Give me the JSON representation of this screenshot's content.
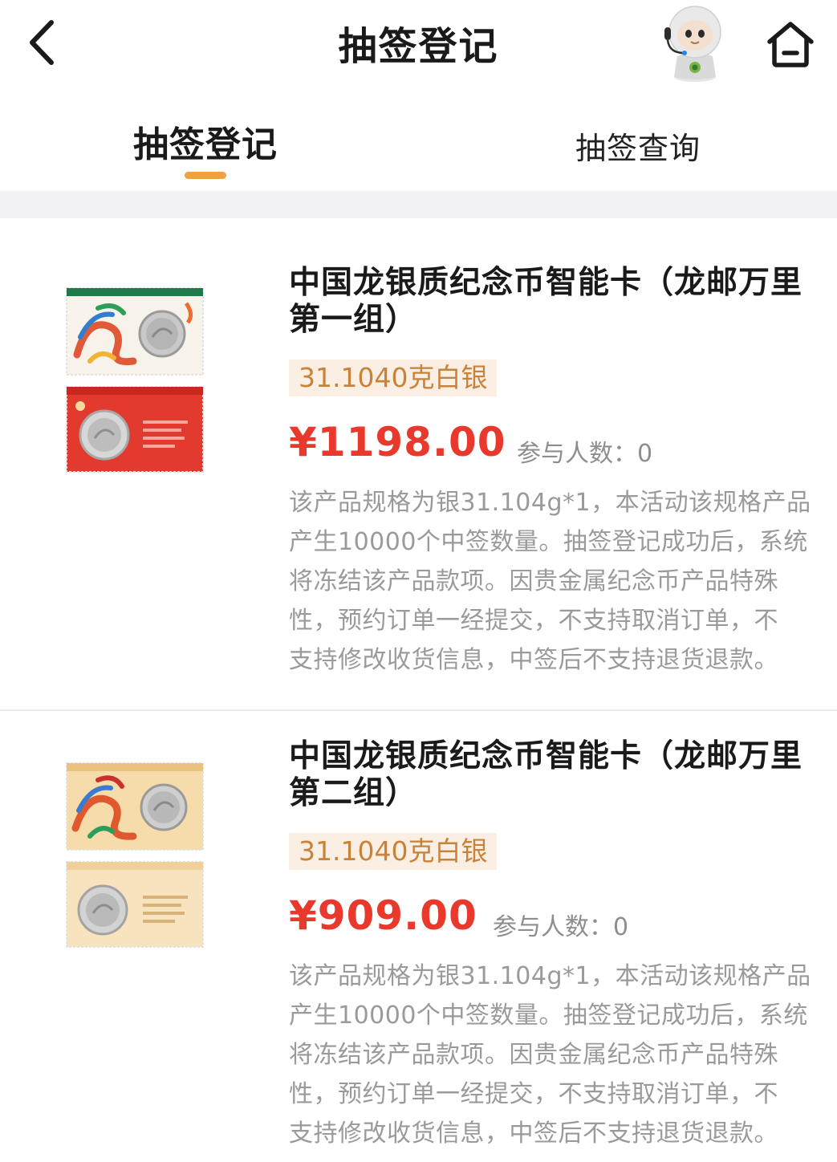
{
  "header": {
    "title": "抽签登记",
    "back_icon": "chevron-left-icon",
    "home_icon": "home-icon",
    "mascot": "robot-mascot"
  },
  "tabs": [
    {
      "label": "抽签登记",
      "active": true
    },
    {
      "label": "抽签查询",
      "active": false
    }
  ],
  "colors": {
    "accent": "#f0a23c",
    "price": "#e8392c",
    "badge_bg": "#fbeee2",
    "badge_text": "#c9823a",
    "muted": "#9a9a9a"
  },
  "products": [
    {
      "title": "中国龙银质纪念币智能卡（龙邮万里第一组）",
      "weight": "31.1040克白银",
      "price": "¥1198.00",
      "participants": "参与人数：0",
      "description": "该产品规格为银31.104g*1，本活动该规格产品\n产生10000个中签数量。抽签登记成功后，系统\n将冻结该产品款项。因贵金属纪念币产品特殊\n性，预约订单一经提交，不支持取消订单，不\n支持修改收货信息，中签后不支持退货退款。"
    },
    {
      "title": "中国龙银质纪念币智能卡（龙邮万里第二组）",
      "weight": "31.1040克白银",
      "price": "¥909.00",
      "participants": "参与人数：0",
      "description": "该产品规格为银31.104g*1，本活动该规格产品\n产生10000个中签数量。抽签登记成功后，系统\n将冻结该产品款项。因贵金属纪念币产品特殊\n性，预约订单一经提交，不支持取消订单，不\n支持修改收货信息，中签后不支持退货退款。"
    }
  ]
}
